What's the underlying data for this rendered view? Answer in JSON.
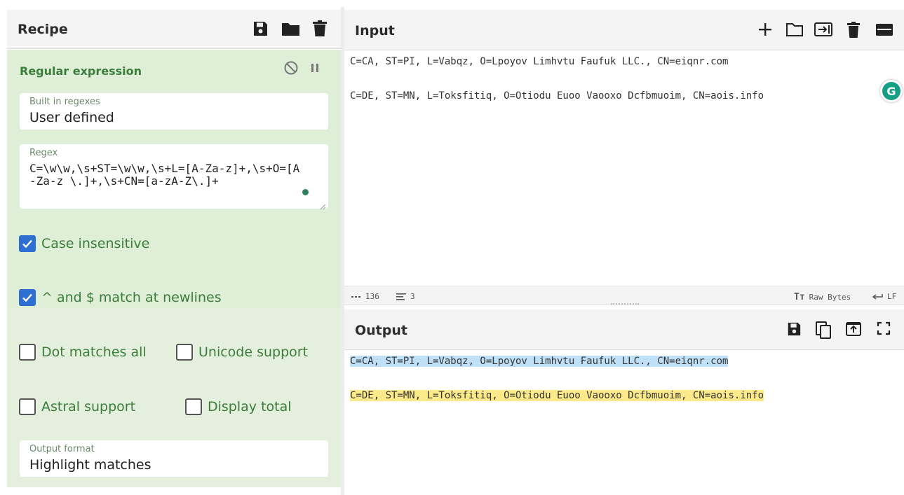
{
  "recipe": {
    "title": "Recipe",
    "operation": {
      "title": "Regular expression",
      "built_in": {
        "label": "Built in regexes",
        "value": "User defined"
      },
      "regex": {
        "label": "Regex",
        "value": "C=\\w\\w,\\s+ST=\\w\\w,\\s+L=[A-Za-z]+,\\s+O=[A-Za-z \\.]+,\\s+CN=[a-zA-Z\\.]+"
      },
      "options": [
        {
          "label": "Case insensitive",
          "checked": true
        },
        {
          "label": "^ and $ match at newlines",
          "checked": true
        },
        {
          "label": "Dot matches all",
          "checked": false
        },
        {
          "label": "Unicode support",
          "checked": false
        },
        {
          "label": "Astral support",
          "checked": false
        },
        {
          "label": "Display total",
          "checked": false
        }
      ],
      "output_format": {
        "label": "Output format",
        "value": "Highlight matches"
      }
    }
  },
  "input": {
    "title": "Input",
    "lines": [
      "C=CA, ST=PI, L=Vabqz, O=Lpoyov Limhvtu Faufuk LLC., CN=eiqnr.com",
      "C=DE, ST=MN, L=Toksfitiq, O=Otiodu Euoo Vaooxo Dcfbmuoim, CN=aois.info"
    ]
  },
  "status": {
    "char_count": "136",
    "line_count": "3",
    "raw_bytes": "Raw Bytes",
    "eol": "LF"
  },
  "output": {
    "title": "Output",
    "lines": [
      "C=CA, ST=PI, L=Vabqz, O=Lpoyov Limhvtu Faufuk LLC., CN=eiqnr.com",
      "C=DE, ST=MN, L=Toksfitiq, O=Otiodu Euoo Vaooxo Dcfbmuoim, CN=aois.info"
    ]
  },
  "grammarly": {
    "glyph": "G"
  },
  "colors": {
    "recipe_bg": "#dfeed7",
    "accent_green": "#3b7d3b",
    "checkbox_blue": "#2f6fd1",
    "highlight_blue": "#bfe0f7",
    "highlight_yellow": "#fbe98a"
  }
}
